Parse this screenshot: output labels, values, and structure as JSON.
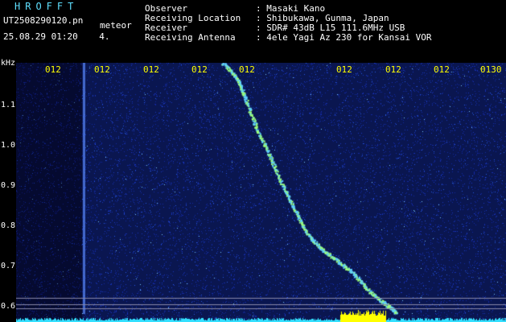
{
  "header": {
    "logo": "HROFFT",
    "filename": "UT2508290120.pn",
    "filetype": "meteor",
    "datetime": "25.08.29 01:20",
    "index": "4.",
    "rows": [
      {
        "label": "Observer",
        "value": ": Masaki Kano"
      },
      {
        "label": "Receiving Location",
        "value": ": Shibukawa, Gunma, Japan"
      },
      {
        "label": "Receiver",
        "value": ": SDR# 43dB L15 111.6MHz USB"
      },
      {
        "label": "Receiving Antenna",
        "value": ": 4ele Yagi Az 230 for Kansai VOR"
      }
    ]
  },
  "plot": {
    "y_unit": "kHz",
    "y_ticks": [
      "1.1",
      "1.0",
      "0.9",
      "0.8",
      "0.7",
      "0.6"
    ],
    "x_ticks": [
      "012",
      "012",
      "012",
      "012",
      "012",
      "012",
      "012",
      "012",
      "0130"
    ],
    "colors": {
      "background": "#0a1650",
      "trace": "#9cff7a",
      "tick_text": "#ffff00",
      "baseline": "#33e0ff",
      "burst": "#ffff00"
    }
  }
}
